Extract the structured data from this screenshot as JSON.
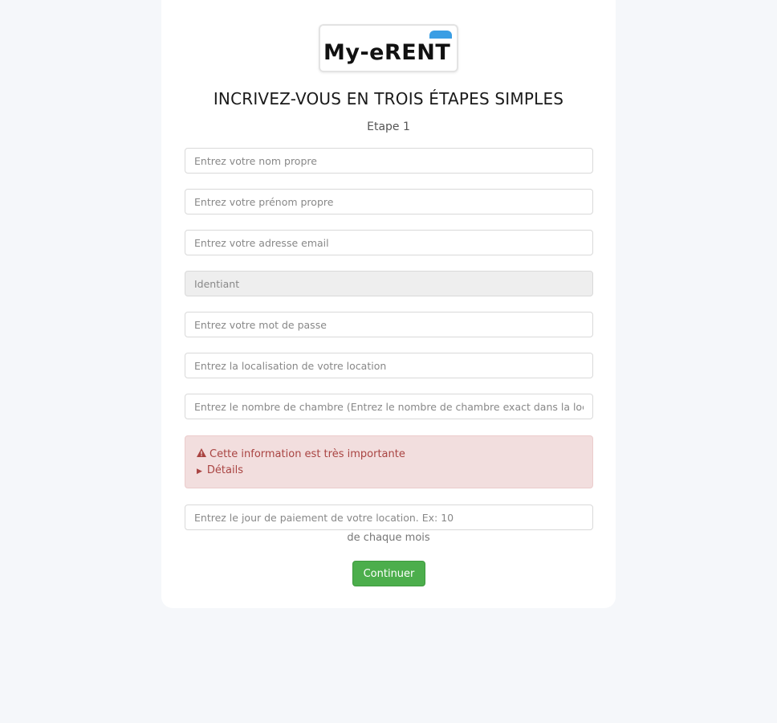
{
  "brand": {
    "logo_text": "My-eRENT",
    "accent_color": "#3a9ee4"
  },
  "header": {
    "title": "INCRIVEZ-VOUS EN TROIS ÉTAPES SIMPLES",
    "step": "Etape 1"
  },
  "form": {
    "fields": [
      {
        "placeholder": "Entrez votre nom propre",
        "value": ""
      },
      {
        "placeholder": "Entrez votre prénom propre",
        "value": ""
      },
      {
        "placeholder": "Entrez votre adresse email",
        "value": ""
      },
      {
        "placeholder": "Identiant",
        "value": "",
        "disabled": true
      },
      {
        "placeholder": "Entrez votre mot de passe",
        "value": ""
      },
      {
        "placeholder": "Entrez la localisation de votre location",
        "value": ""
      },
      {
        "placeholder": "Entrez le nombre de chambre (Entrez le nombre de chambre exact dans la location)",
        "value": ""
      },
      {
        "placeholder": "Entrez le jour de paiement de votre location. Ex: 10",
        "value": ""
      }
    ],
    "alert": {
      "icon": "warning-icon",
      "message": "Cette information est très importante",
      "details_label": "Détails",
      "color": "#a94442",
      "background": "#f2dede"
    },
    "payment_helper": "de chaque mois",
    "submit_label": "Continuer",
    "submit_color": "#4cae4c"
  }
}
